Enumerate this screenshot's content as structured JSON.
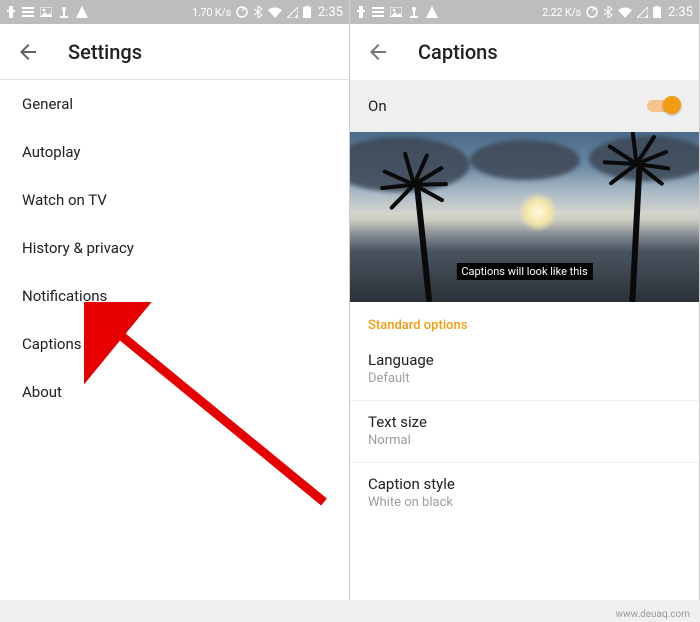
{
  "left": {
    "status": {
      "speed": "1.70 K/s",
      "time": "2:35"
    },
    "appbar": {
      "title": "Settings"
    },
    "menu": [
      "General",
      "Autoplay",
      "Watch on TV",
      "History & privacy",
      "Notifications",
      "Captions",
      "About"
    ]
  },
  "right": {
    "status": {
      "speed": "2.22 K/s",
      "time": "2:35"
    },
    "appbar": {
      "title": "Captions"
    },
    "toggle": {
      "label": "On",
      "enabled": true
    },
    "preview_caption": "Captions will look like this",
    "section_header": "Standard options",
    "options": [
      {
        "title": "Language",
        "value": "Default"
      },
      {
        "title": "Text size",
        "value": "Normal"
      },
      {
        "title": "Caption style",
        "value": "White on black"
      }
    ]
  },
  "watermark": "www.deuaq.com"
}
